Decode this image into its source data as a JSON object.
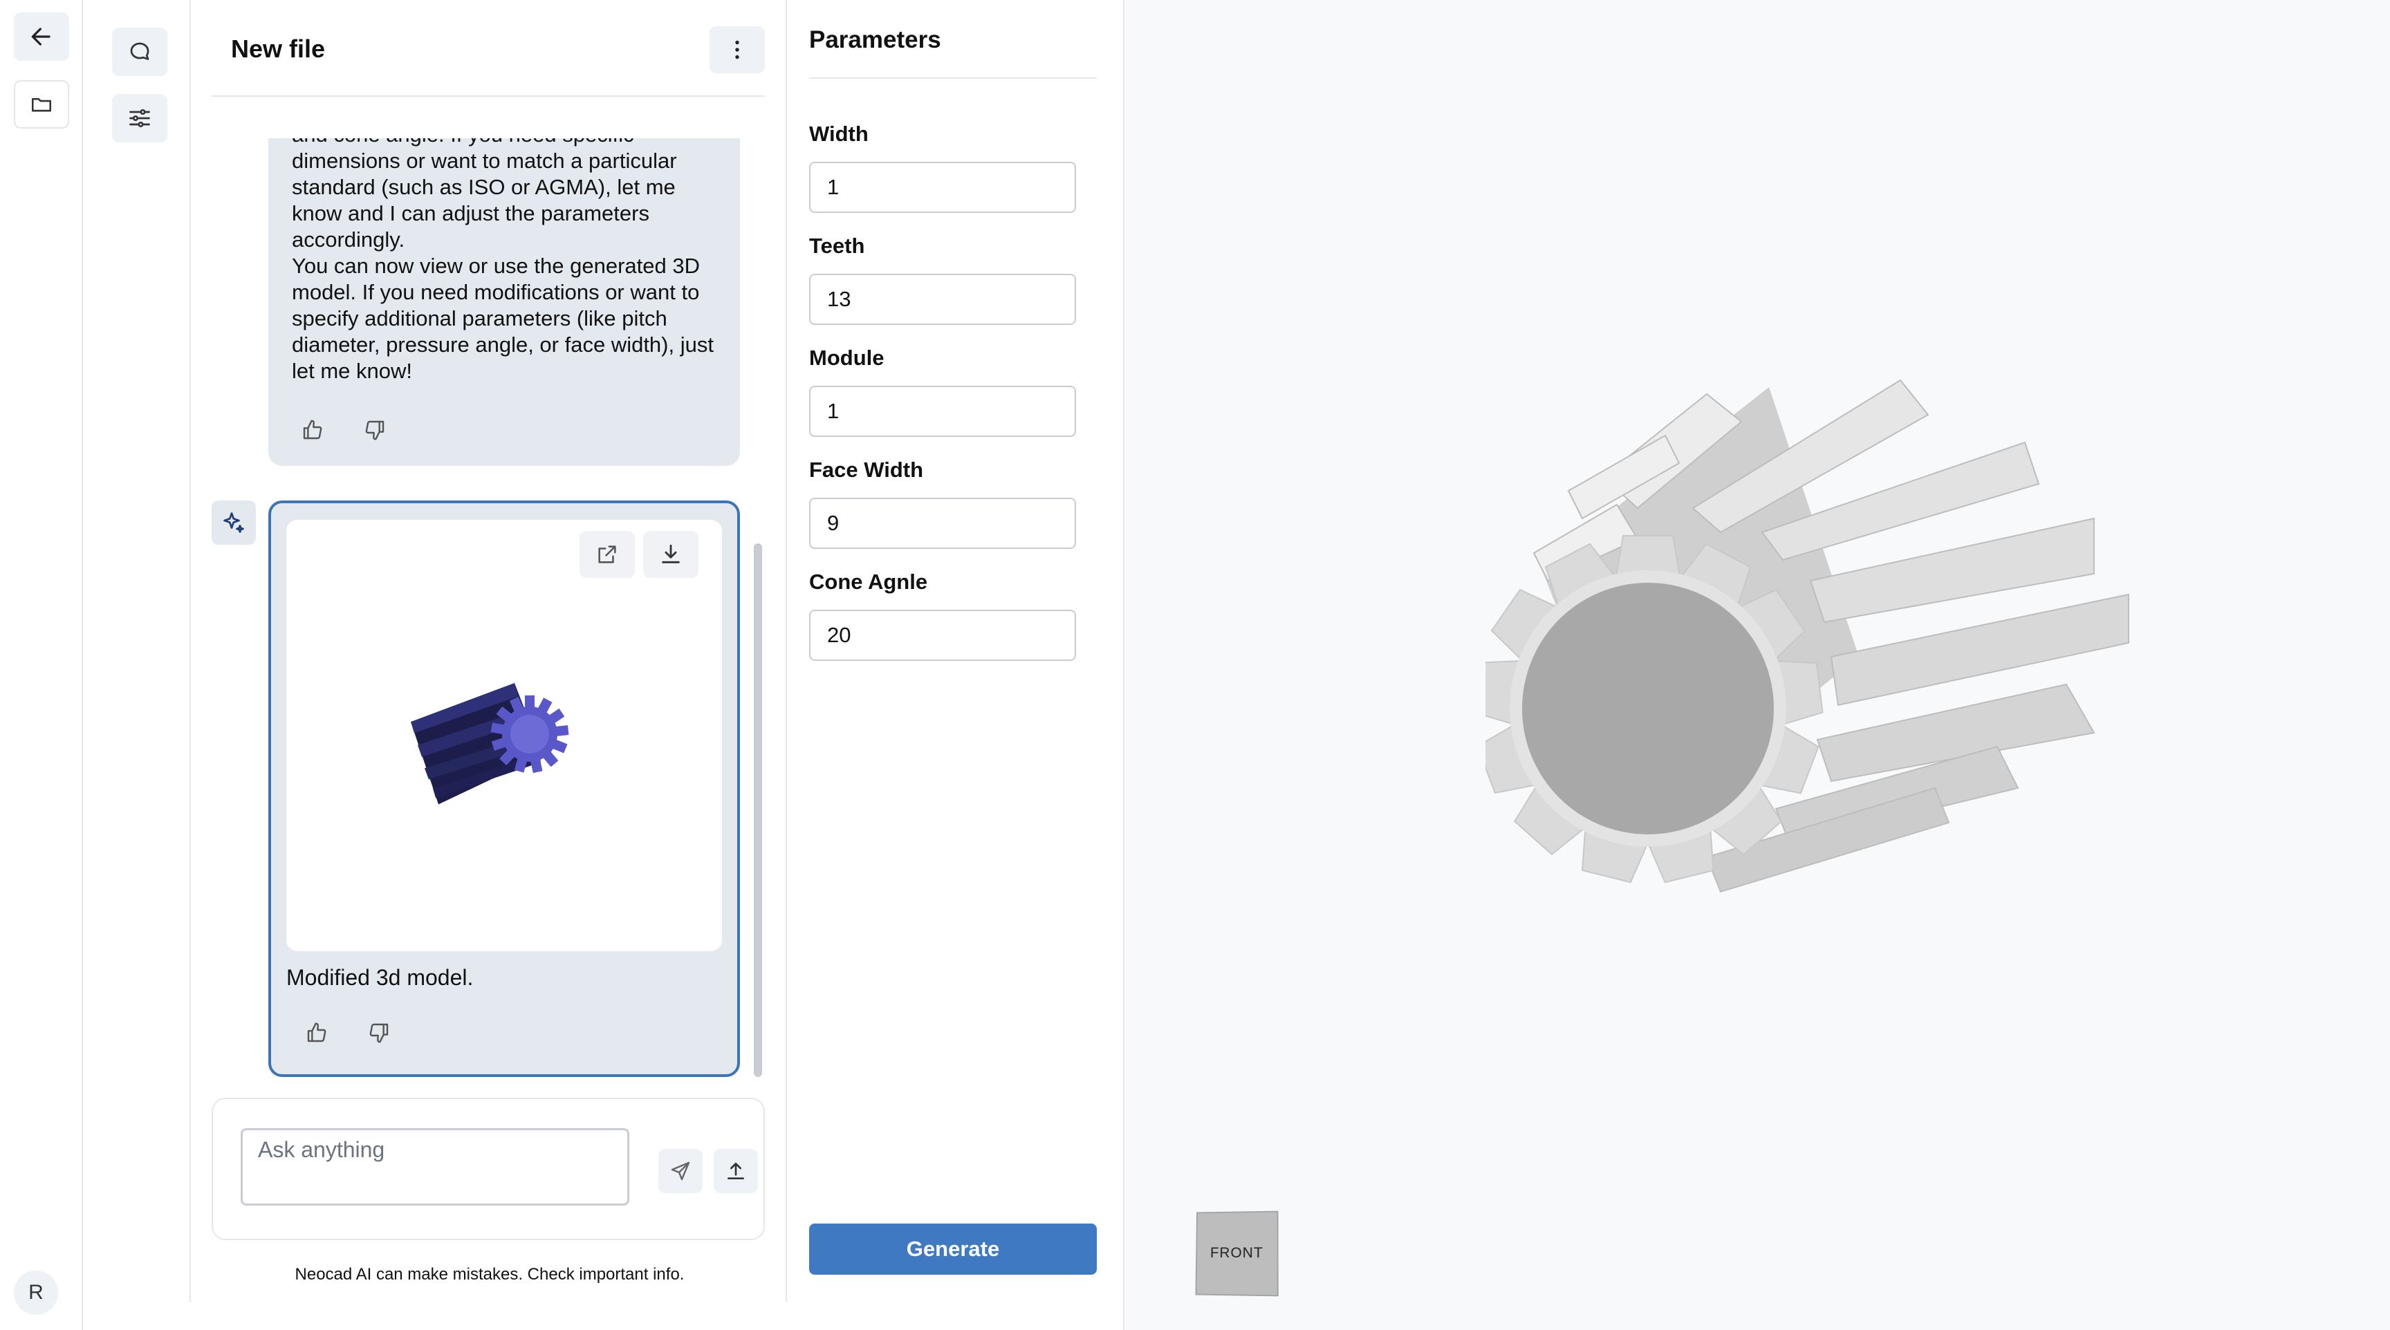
{
  "colors": {
    "accent": "#3f79c1",
    "selected_border": "#3b74b9",
    "bubble_bg": "#e4e8ef",
    "gear_preview": "#2b2d6b",
    "gear_viewport": "#d8d8d8"
  },
  "rail": {
    "back_icon": "arrow-left-icon",
    "folder_icon": "folder-icon",
    "avatar_initial": "R"
  },
  "tools": {
    "chat_icon": "chat-bubble-icon",
    "settings_icon": "sliders-icon"
  },
  "chat": {
    "title": "New file",
    "menu_icon": "more-vertical-icon",
    "messages": [
      {
        "text_lines": [
          "and cone angle. If you need specific",
          "dimensions or want to match a particular",
          "standard (such as ISO or AGMA), let me",
          "know and I can adjust the parameters",
          "accordingly.",
          "You can now view or use the generated 3D",
          "model. If you need modifications or want to",
          "specify additional parameters (like pitch",
          "diameter, pressure angle, or face width), just",
          "let me know!"
        ]
      },
      {
        "text": "Modified 3d model.",
        "open_icon": "external-link-icon",
        "download_icon": "download-icon"
      }
    ],
    "composer": {
      "placeholder": "Ask anything",
      "send_icon": "send-icon",
      "upload_icon": "upload-icon"
    },
    "disclaimer": "Neocad AI can make mistakes. Check important info."
  },
  "parameters": {
    "title": "Parameters",
    "fields": [
      {
        "label": "Width",
        "value": "1"
      },
      {
        "label": "Teeth",
        "value": "13"
      },
      {
        "label": "Module",
        "value": "1"
      },
      {
        "label": "Face Width",
        "value": "9"
      },
      {
        "label": "Cone Agnle",
        "value": "20"
      }
    ],
    "generate_label": "Generate"
  },
  "viewport": {
    "view_cube_label": "FRONT"
  }
}
